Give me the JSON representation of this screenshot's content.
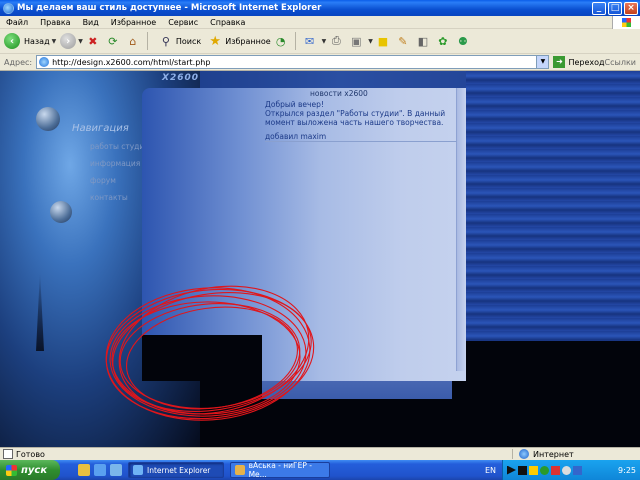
{
  "window": {
    "title": "Мы делаем ваш стиль доступнее - Microsoft Internet Explorer",
    "buttons": [
      "_",
      "□",
      "×"
    ]
  },
  "menu": [
    "Файл",
    "Правка",
    "Вид",
    "Избранное",
    "Сервис",
    "Справка"
  ],
  "toolbar": {
    "back_label": "Назад",
    "search_label": "Поиск",
    "favorites_label": "Избранное"
  },
  "address": {
    "label": "Адрес:",
    "url": "http://design.x2600.com/html/start.php",
    "go_label": "Переход",
    "links_label": "Ссылки"
  },
  "site": {
    "logo": "X2600",
    "nav_title": "Навигация",
    "nav_items": [
      "работы студии",
      "информация",
      "форум",
      "контакты"
    ],
    "news_title": "новости x2600",
    "news_lines": [
      "Добрый вечер!",
      "Открылся раздел \"Работы студии\". В данный",
      "момент выложена часть нашего творчества.",
      "добавил maxim"
    ]
  },
  "status": {
    "text": "Готово",
    "zone": "Интернет"
  },
  "taskbar": {
    "start_label": "пуск",
    "tasks": [
      "Internet Explorer",
      "вАська - ниГЕР - Ме..."
    ],
    "lang": "EN",
    "clock": "9:25"
  },
  "colors": {
    "titlebar": "#0a4fd0",
    "taskbar": "#245edb",
    "scribble": "#e0161b"
  }
}
